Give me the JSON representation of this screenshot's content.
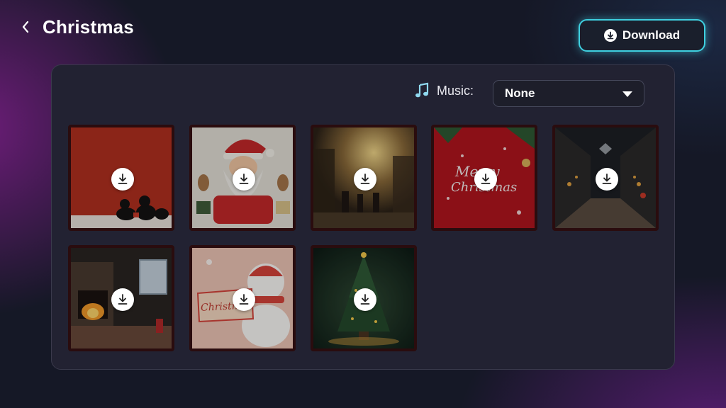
{
  "page": {
    "title": "Christmas"
  },
  "header": {
    "download_label": "Download"
  },
  "music": {
    "label": "Music:",
    "selected": "None"
  },
  "tiles": [
    {
      "name": "cats-red"
    },
    {
      "name": "santa-reindeer"
    },
    {
      "name": "market-street"
    },
    {
      "name": "merry-christmas-card",
      "text_line1": "Merry",
      "text_line2": "Christmas"
    },
    {
      "name": "night-street"
    },
    {
      "name": "fireplace-room"
    },
    {
      "name": "snowman-sign",
      "sign_text": "Christmas"
    },
    {
      "name": "christmas-tree"
    }
  ],
  "colors": {
    "accent": "#3fd0e0",
    "panel": "#222232",
    "background": "#151826"
  }
}
